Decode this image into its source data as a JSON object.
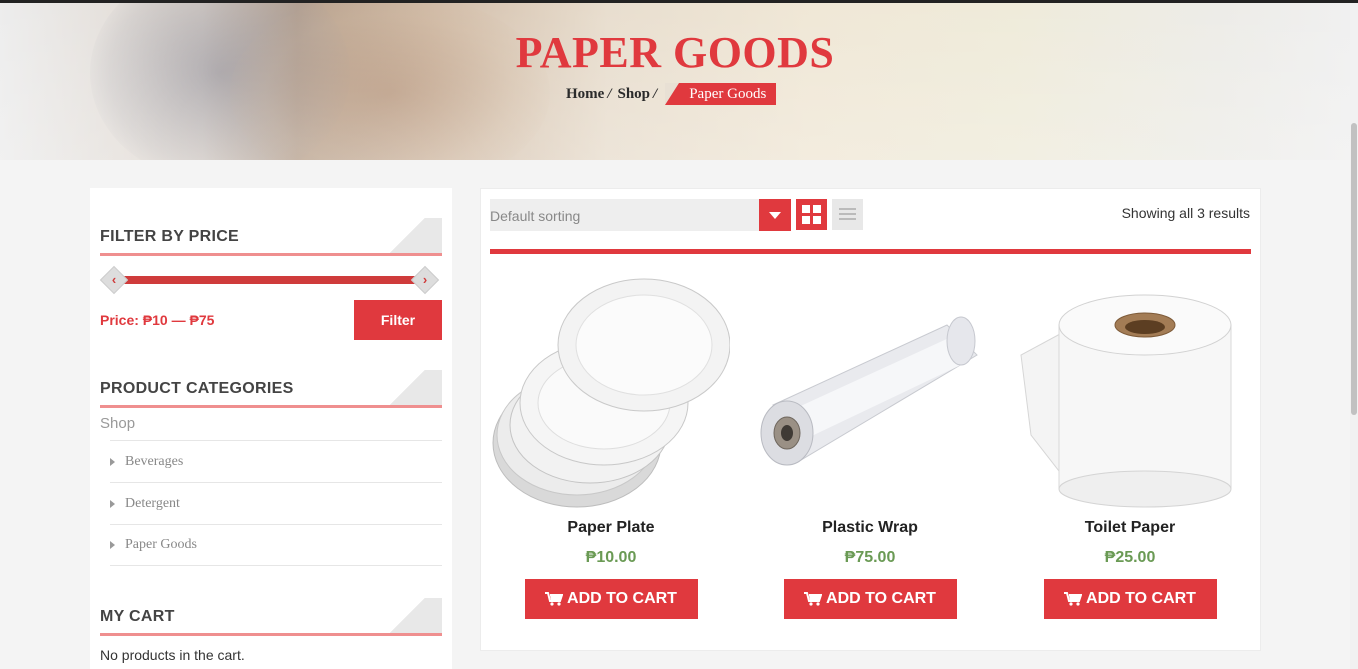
{
  "hero": {
    "title": "PAPER GOODS",
    "breadcrumb": [
      "Home",
      "Shop",
      "Paper Goods"
    ],
    "separator": "/"
  },
  "sidebar": {
    "filter": {
      "title": "FILTER BY PRICE",
      "price_label": "Price: ₱10 — ₱75",
      "button": "Filter",
      "min": 10,
      "max": 75
    },
    "categories": {
      "title": "PRODUCT CATEGORIES",
      "root": "Shop",
      "items": [
        "Beverages",
        "Detergent",
        "Paper Goods"
      ]
    },
    "cart": {
      "title": "MY CART",
      "empty_text": "No products in the cart."
    }
  },
  "toolbar": {
    "sort_value": "Default sorting",
    "result_count": "Showing all 3 results"
  },
  "products": [
    {
      "name": "Paper Plate",
      "price": "₱10.00",
      "button": "ADD TO CART",
      "icon": "paper-plate-image"
    },
    {
      "name": "Plastic Wrap",
      "price": "₱75.00",
      "button": "ADD TO CART",
      "icon": "plastic-wrap-image"
    },
    {
      "name": "Toilet Paper",
      "price": "₱25.00",
      "button": "ADD TO CART",
      "icon": "toilet-paper-image"
    }
  ],
  "colors": {
    "accent": "#e0393e",
    "price_green": "#6a9a54",
    "divider": "#ef8f8f"
  }
}
